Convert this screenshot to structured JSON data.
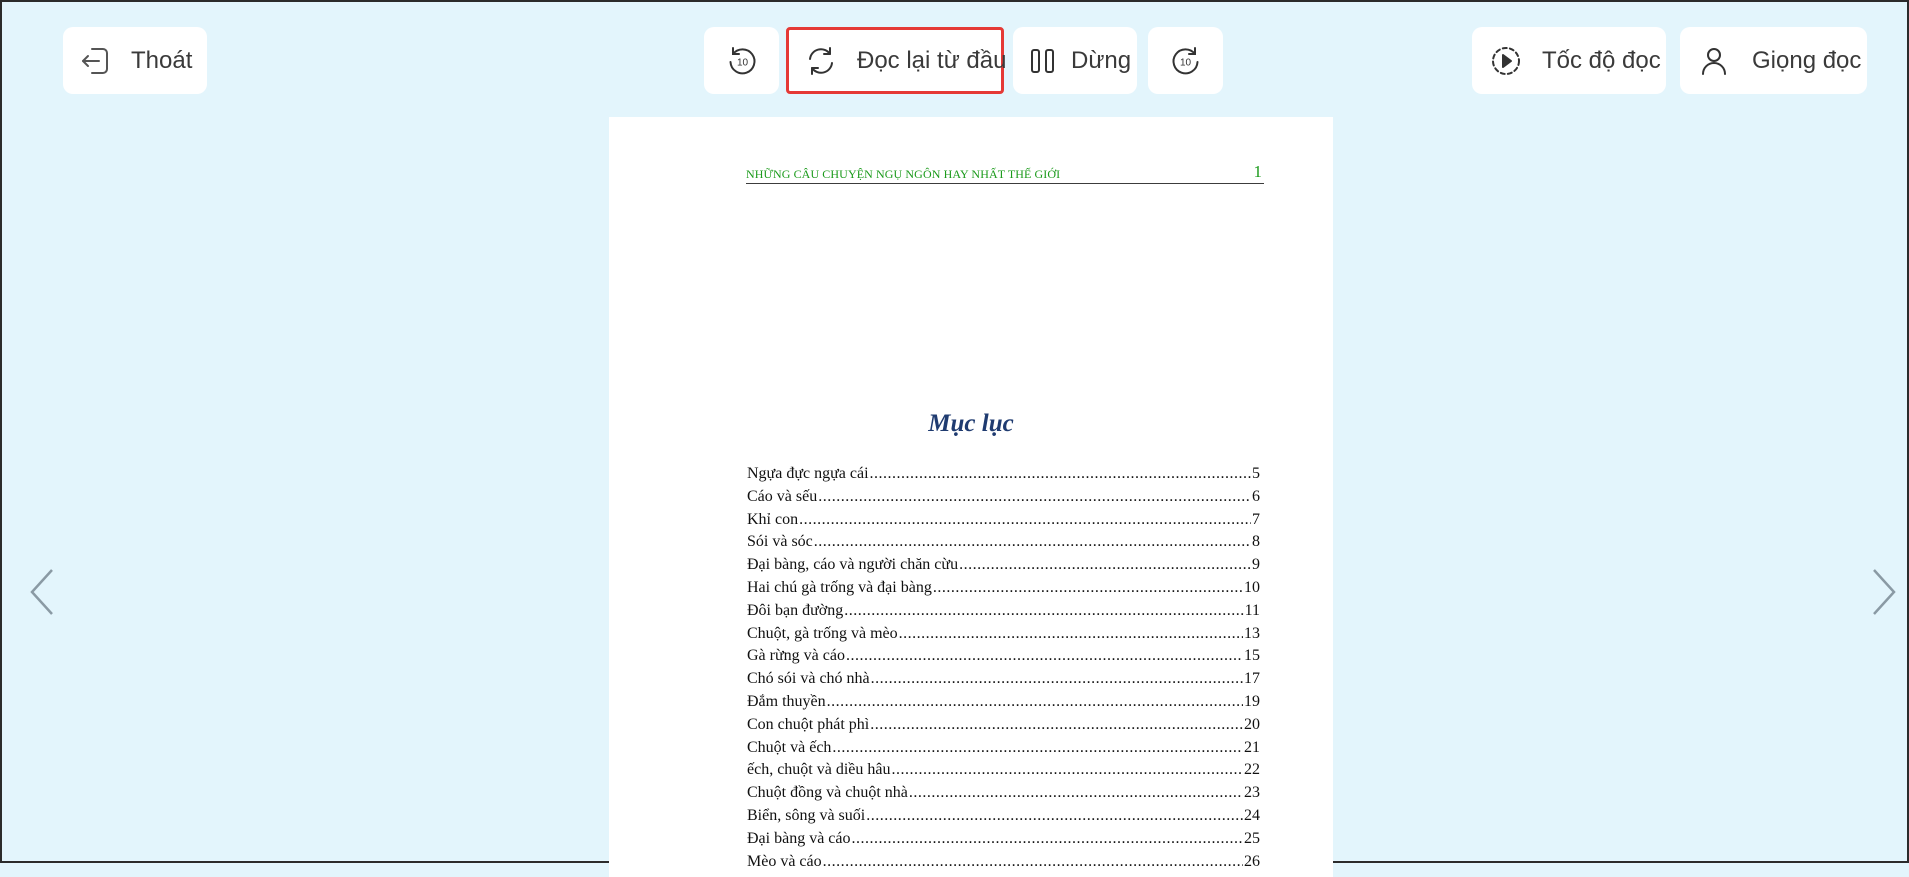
{
  "toolbar": {
    "exit_label": "Thoát",
    "rewind_label": "10",
    "restart_label": "Đọc lại từ đầu",
    "pause_label": "Dừng",
    "forward_label": "10",
    "speed_label": "Tốc độ đọc",
    "voice_label": "Giọng đọc"
  },
  "icons": {
    "exit": "exit-icon",
    "rewind": "rewind-10-icon",
    "restart": "refresh-icon",
    "pause": "pause-icon",
    "forward": "forward-10-icon",
    "speed": "speed-play-icon",
    "voice": "user-icon",
    "prev": "chevron-left-icon",
    "next": "chevron-right-icon"
  },
  "colors": {
    "background": "#e3f5fc",
    "highlight_border": "#e53935",
    "running_head": "#1a9a1a",
    "toc_heading": "#1f3b70"
  },
  "page": {
    "running_head_title": "NHỮNG CÂU CHUYỆN NGỤ NGÔN HAY NHẤT THẾ GIỚI",
    "page_number": "1",
    "toc_title": "Mục lục",
    "toc": [
      {
        "title": "Ngựa đực ngựa cái",
        "page": "5"
      },
      {
        "title": "Cáo và sếu",
        "page": "6"
      },
      {
        "title": "Khỉ con",
        "page": "7"
      },
      {
        "title": "Sói và sóc",
        "page": "8"
      },
      {
        "title": "Đại bàng, cáo và người chăn cừu",
        "page": "9"
      },
      {
        "title": "Hai chú gà trống và đại bàng",
        "page": "10"
      },
      {
        "title": "Đôi bạn đường",
        "page": "11"
      },
      {
        "title": "Chuột, gà trống và mèo",
        "page": "13"
      },
      {
        "title": "Gà rừng và cáo",
        "page": "15"
      },
      {
        "title": "Chó sói và chó nhà",
        "page": "17"
      },
      {
        "title": "Đắm thuyền",
        "page": "19"
      },
      {
        "title": "Con chuột phát phì",
        "page": "20"
      },
      {
        "title": "Chuột và ếch",
        "page": "21"
      },
      {
        "title": "ếch, chuột và diều hâu",
        "page": "22"
      },
      {
        "title": "Chuột đồng và chuột nhà",
        "page": "23"
      },
      {
        "title": "Biển, sông và suối",
        "page": "24"
      },
      {
        "title": "Đại bàng và cáo",
        "page": "25"
      },
      {
        "title": "Mèo và cáo",
        "page": "26"
      }
    ]
  }
}
